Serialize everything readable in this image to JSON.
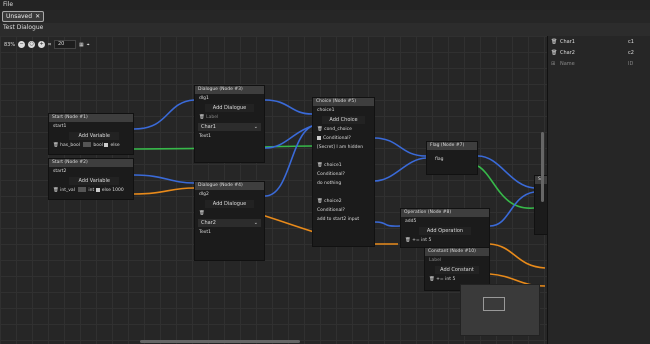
{
  "menu": {
    "file": "File"
  },
  "tab": {
    "label": "Unsaved"
  },
  "doc_title": "Test Dialogue",
  "toolbar": {
    "zoom": "83%",
    "snap": "20"
  },
  "nodes": {
    "start1": {
      "title": "Start (Node #1)",
      "value": "start1",
      "add": "Add Variable",
      "var": "has_bool",
      "type": "bool",
      "else": "else"
    },
    "start2": {
      "title": "Start (Node #2)",
      "value": "start2",
      "add": "Add Variable",
      "var": "int_val",
      "type": "int",
      "else": "else",
      "num": "1000"
    },
    "dlg3": {
      "title": "Dialogue (Node #3)",
      "id": "dlg1",
      "add": "Add Dialogue",
      "label": "Label",
      "char": "Char1",
      "text": "Text1"
    },
    "dlg4": {
      "title": "Dialogue (Node #4)",
      "id": "dlg2",
      "add": "Add Dialogue",
      "char": "Char2",
      "text": "Text1"
    },
    "choice5": {
      "title": "Choice (Node #5)",
      "id": "choice1",
      "add": "Add Choice",
      "c1": "cond_choice",
      "cond": "Conditional?",
      "secret": "[Secret] I am hidden",
      "c2": "choice1",
      "cond2": "Conditional?",
      "nothing": "do nothing",
      "c3": "choice2",
      "cond3": "Conditional?",
      "addto": "add to start2 input"
    },
    "flag7": {
      "title": "Flag (Node #7)",
      "value": "flag"
    },
    "op8": {
      "title": "Operation (Node #8)",
      "value": "add5",
      "add": "Add Operation",
      "op": "+=",
      "type": "int",
      "num": "5"
    },
    "const10": {
      "title": "Constant (Node #10)",
      "label": "Label",
      "add": "Add Constant",
      "op": "+=",
      "type": "int",
      "num": "5"
    },
    "sys": {
      "label": "Sy"
    }
  },
  "characters": [
    {
      "name": "Char1",
      "value": "c1"
    },
    {
      "name": "Char2",
      "value": "c2"
    },
    {
      "name": "Name",
      "value": "ID"
    }
  ],
  "colors": {
    "wire_blue": "#3a6ad8",
    "wire_green": "#37b94a",
    "wire_orange": "#e88a1a"
  }
}
